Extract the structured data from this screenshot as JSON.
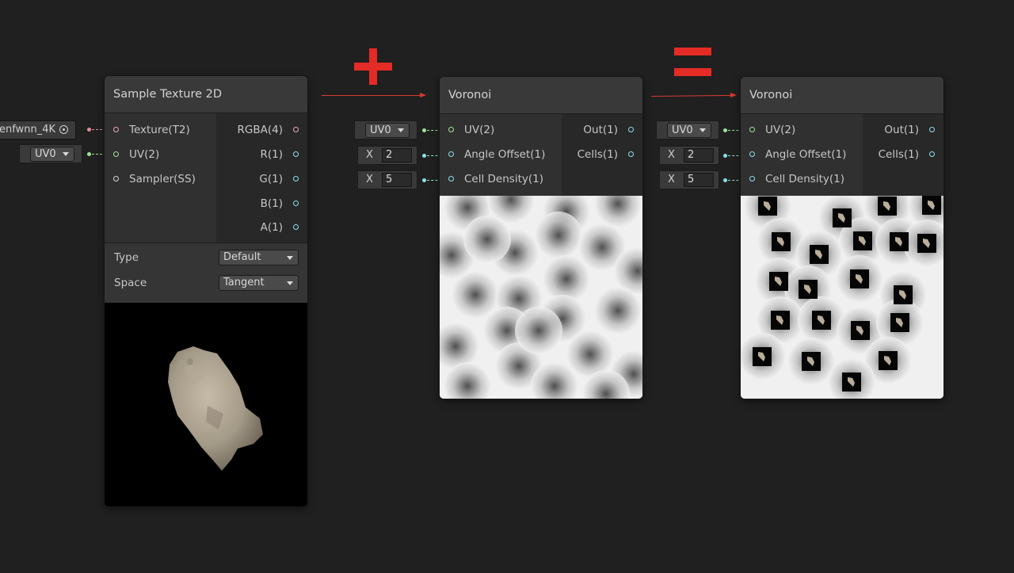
{
  "sample_node": {
    "title": "Sample Texture 2D",
    "inputs": {
      "texture": "Texture(T2)",
      "uv": "UV(2)",
      "sampler": "Sampler(SS)"
    },
    "outputs": {
      "rgba": "RGBA(4)",
      "r": "R(1)",
      "g": "G(1)",
      "b": "B(1)",
      "a": "A(1)"
    },
    "type_label": "Type",
    "type_value": "Default",
    "space_label": "Space",
    "space_value": "Tangent",
    "texture_field_value": "enfwnn_4K",
    "uv_dropdown_value": "UV0"
  },
  "voronoi_left": {
    "title": "Voronoi",
    "inputs": {
      "uv": "UV(2)",
      "angle_offset": "Angle Offset(1)",
      "cell_density": "Cell Density(1)"
    },
    "outputs": {
      "out": "Out(1)",
      "cells": "Cells(1)"
    },
    "uv_dropdown_value": "UV0",
    "angle_axis": "X",
    "angle_value": "2",
    "density_axis": "X",
    "density_value": "5"
  },
  "voronoi_right": {
    "title": "Voronoi",
    "inputs": {
      "uv": "UV(2)",
      "angle_offset": "Angle Offset(1)",
      "cell_density": "Cell Density(1)"
    },
    "outputs": {
      "out": "Out(1)",
      "cells": "Cells(1)"
    },
    "uv_dropdown_value": "UV0",
    "angle_axis": "X",
    "angle_value": "2",
    "density_axis": "X",
    "density_value": "5"
  },
  "colors": {
    "background": "#202020",
    "node_body": "#2f2f2f",
    "node_title": "#393939",
    "operator_red": "#e52b25",
    "port_cyan": "#8ee0e8",
    "port_pink": "#f1a7b8",
    "port_green": "#9ee29c"
  },
  "icons": {
    "plus": "plus-icon",
    "equals": "equals-icon",
    "arrow": "arrow-right-icon",
    "target": "object-picker-icon",
    "caret": "chevron-down-icon"
  }
}
